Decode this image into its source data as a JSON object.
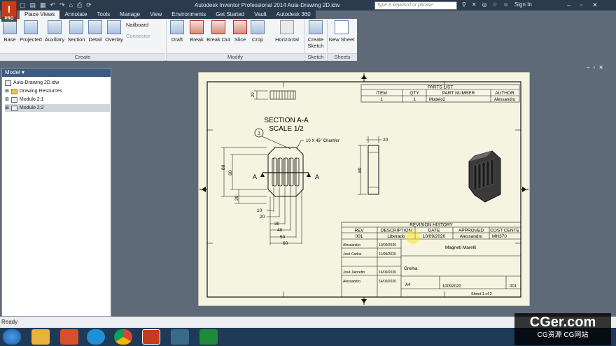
{
  "titlebar": {
    "app_title": "Autodesk Inventor Professional 2014    Aula-Drawing 2D.idw",
    "search_placeholder": "Type a keyword or phrase",
    "sign_in": "Sign In"
  },
  "tabs": [
    "Place Views",
    "Annotate",
    "Tools",
    "Manage",
    "View",
    "Environments",
    "Get Started",
    "Vault",
    "Autodesk 360"
  ],
  "ribbon": {
    "create_tools": [
      "Base",
      "Projected",
      "Auxiliary",
      "Section",
      "Detail",
      "Overlay"
    ],
    "nailboard": "Nailboard",
    "connector": "Connector",
    "create_group": "Create",
    "modify_tools": [
      "Draft",
      "Break",
      "Break Out",
      "Slice",
      "Crop",
      "Horizontal"
    ],
    "modify_group": "Modify",
    "create_sketch": "Create Sketch",
    "sketch_group": "Sketch",
    "new_sheet": "New Sheet",
    "sheets_group": "Sheets"
  },
  "browser": {
    "header": "Model",
    "items": [
      "Aula-Drawing 2D.idw",
      "Drawing Resources",
      "Modulo 2:1",
      "Modulo 2:2"
    ]
  },
  "drawing": {
    "section_title": "SECTION A-A",
    "scale": "SCALE 1/2",
    "chamfer": "10 X 45° Chamfer",
    "balloon": "1",
    "section_letter": "A",
    "dims_left": [
      "80",
      "60",
      "20"
    ],
    "dims_bottom": [
      "10",
      "20",
      "30",
      "40",
      "50",
      "60"
    ],
    "dim_top": "20",
    "dim_side_w": "20",
    "dim_side_h": "80",
    "parts_list": {
      "title": "PARTS LIST",
      "headers": [
        "ITEM",
        "QTY",
        "PART NUMBER",
        "AUTHOR"
      ],
      "row": [
        "1",
        "1",
        "Modelo2",
        "Alessandro"
      ]
    },
    "revision": {
      "title": "REVISION HISTORY",
      "headers": [
        "REV",
        "DESCRIPTION",
        "DATE",
        "APPROVED",
        "COST CENTE"
      ],
      "row": [
        "001",
        "Liberado",
        "10/09/2020",
        "Alessandro",
        "MH370"
      ]
    },
    "title_block": {
      "designer": "Alessandro",
      "date1": "10/09/2020",
      "checker": "José Carlos",
      "date2": "11/09/2020",
      "approver": "José Jaloretto",
      "date3": "16/09/2020",
      "manager": "Alessandro",
      "date4": "14/09/2020",
      "company": "Magneti Marelli",
      "part": "Grelha",
      "size": "A4",
      "dwg_no": "10092020",
      "rev": "001",
      "sheet": "Sheet 1  of 2"
    }
  },
  "status": "Ready",
  "watermark": {
    "line1": "CGer.com",
    "line2": "CG资源 CG网站"
  }
}
